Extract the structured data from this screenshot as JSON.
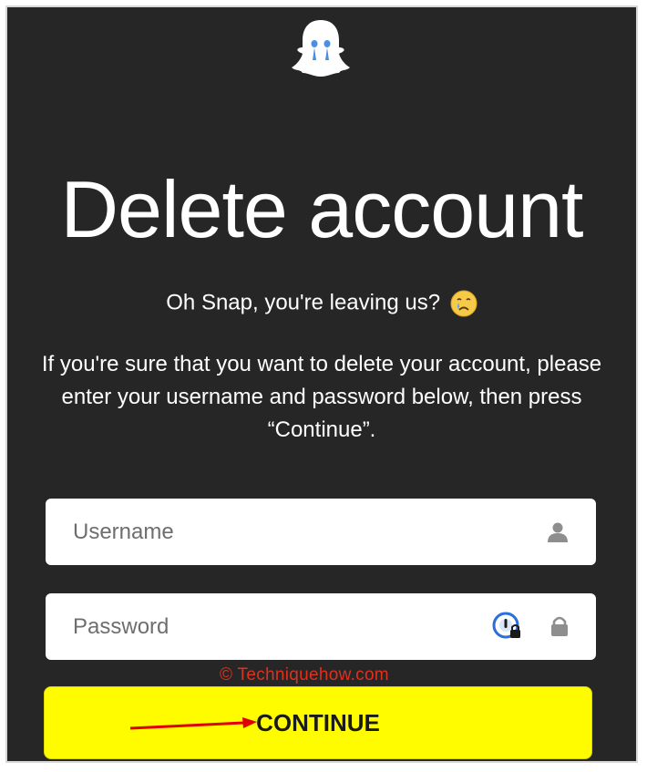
{
  "page": {
    "title": "Delete account",
    "subtitle": "Oh Snap, you're leaving us?",
    "emoji": "crying-face-emoji",
    "description_lines": [
      "If you're sure that you want to delete your account, please",
      "enter your username and password below, then press",
      "“Continue”."
    ]
  },
  "form": {
    "username_placeholder": "Username",
    "password_placeholder": "Password",
    "username_icon": "person-icon",
    "password_icon": "lock-icon",
    "password_manager_icon": "password-manager-icon",
    "continue_label": "CONTINUE"
  },
  "watermark": "© Techniquehow.com",
  "annotation": {
    "arrow": "red-arrow-pointing-to-continue"
  },
  "colors": {
    "background": "#262626",
    "button": "#fffc00",
    "watermark": "#e0301e",
    "arrow": "#e00000"
  }
}
